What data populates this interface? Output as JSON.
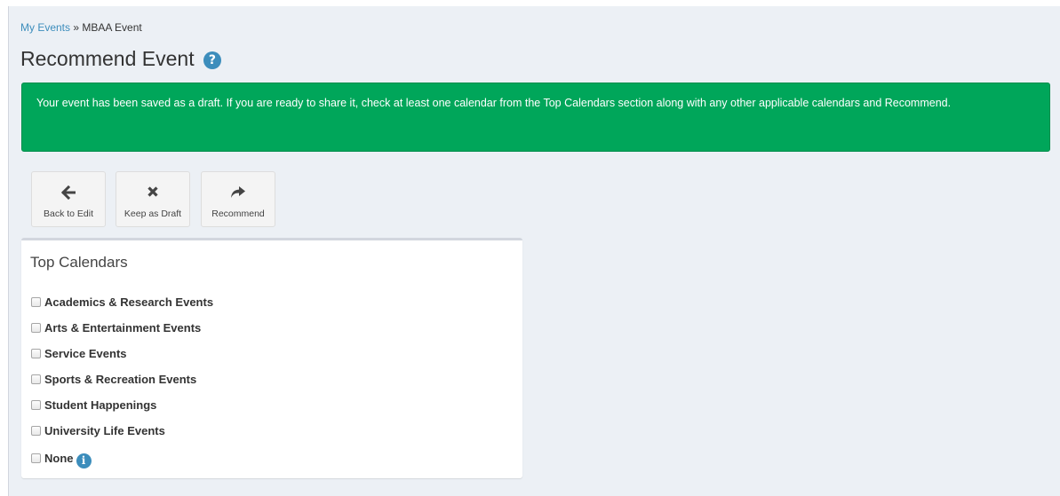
{
  "breadcrumb": {
    "root": "My Events",
    "separator": " » ",
    "current": "MBAA Event"
  },
  "page": {
    "title": "Recommend Event",
    "help_icon": "question-circle-icon"
  },
  "alert": {
    "message": "Your event has been saved as a draft. If you are ready to share it, check at least one calendar from the Top Calendars section along with any other applicable calendars and Recommend."
  },
  "toolbar": {
    "buttons": [
      {
        "label": "Back to Edit",
        "icon": "arrow-left-icon"
      },
      {
        "label": "Keep as Draft",
        "icon": "times-icon"
      },
      {
        "label": "Recommend",
        "icon": "share-icon"
      }
    ]
  },
  "top_calendars": {
    "title": "Top Calendars",
    "items": [
      {
        "label": "Academics & Research Events",
        "checked": false
      },
      {
        "label": "Arts & Entertainment Events",
        "checked": false
      },
      {
        "label": "Service Events",
        "checked": false
      },
      {
        "label": "Sports & Recreation Events",
        "checked": false
      },
      {
        "label": "Student Happenings",
        "checked": false
      },
      {
        "label": "University Life Events",
        "checked": false
      },
      {
        "label": "None",
        "checked": false,
        "info_icon": "info-circle-icon"
      }
    ]
  },
  "colors": {
    "alert_bg": "#00a65a",
    "link": "#3c8dbc",
    "page_bg": "#ecf0f5"
  }
}
